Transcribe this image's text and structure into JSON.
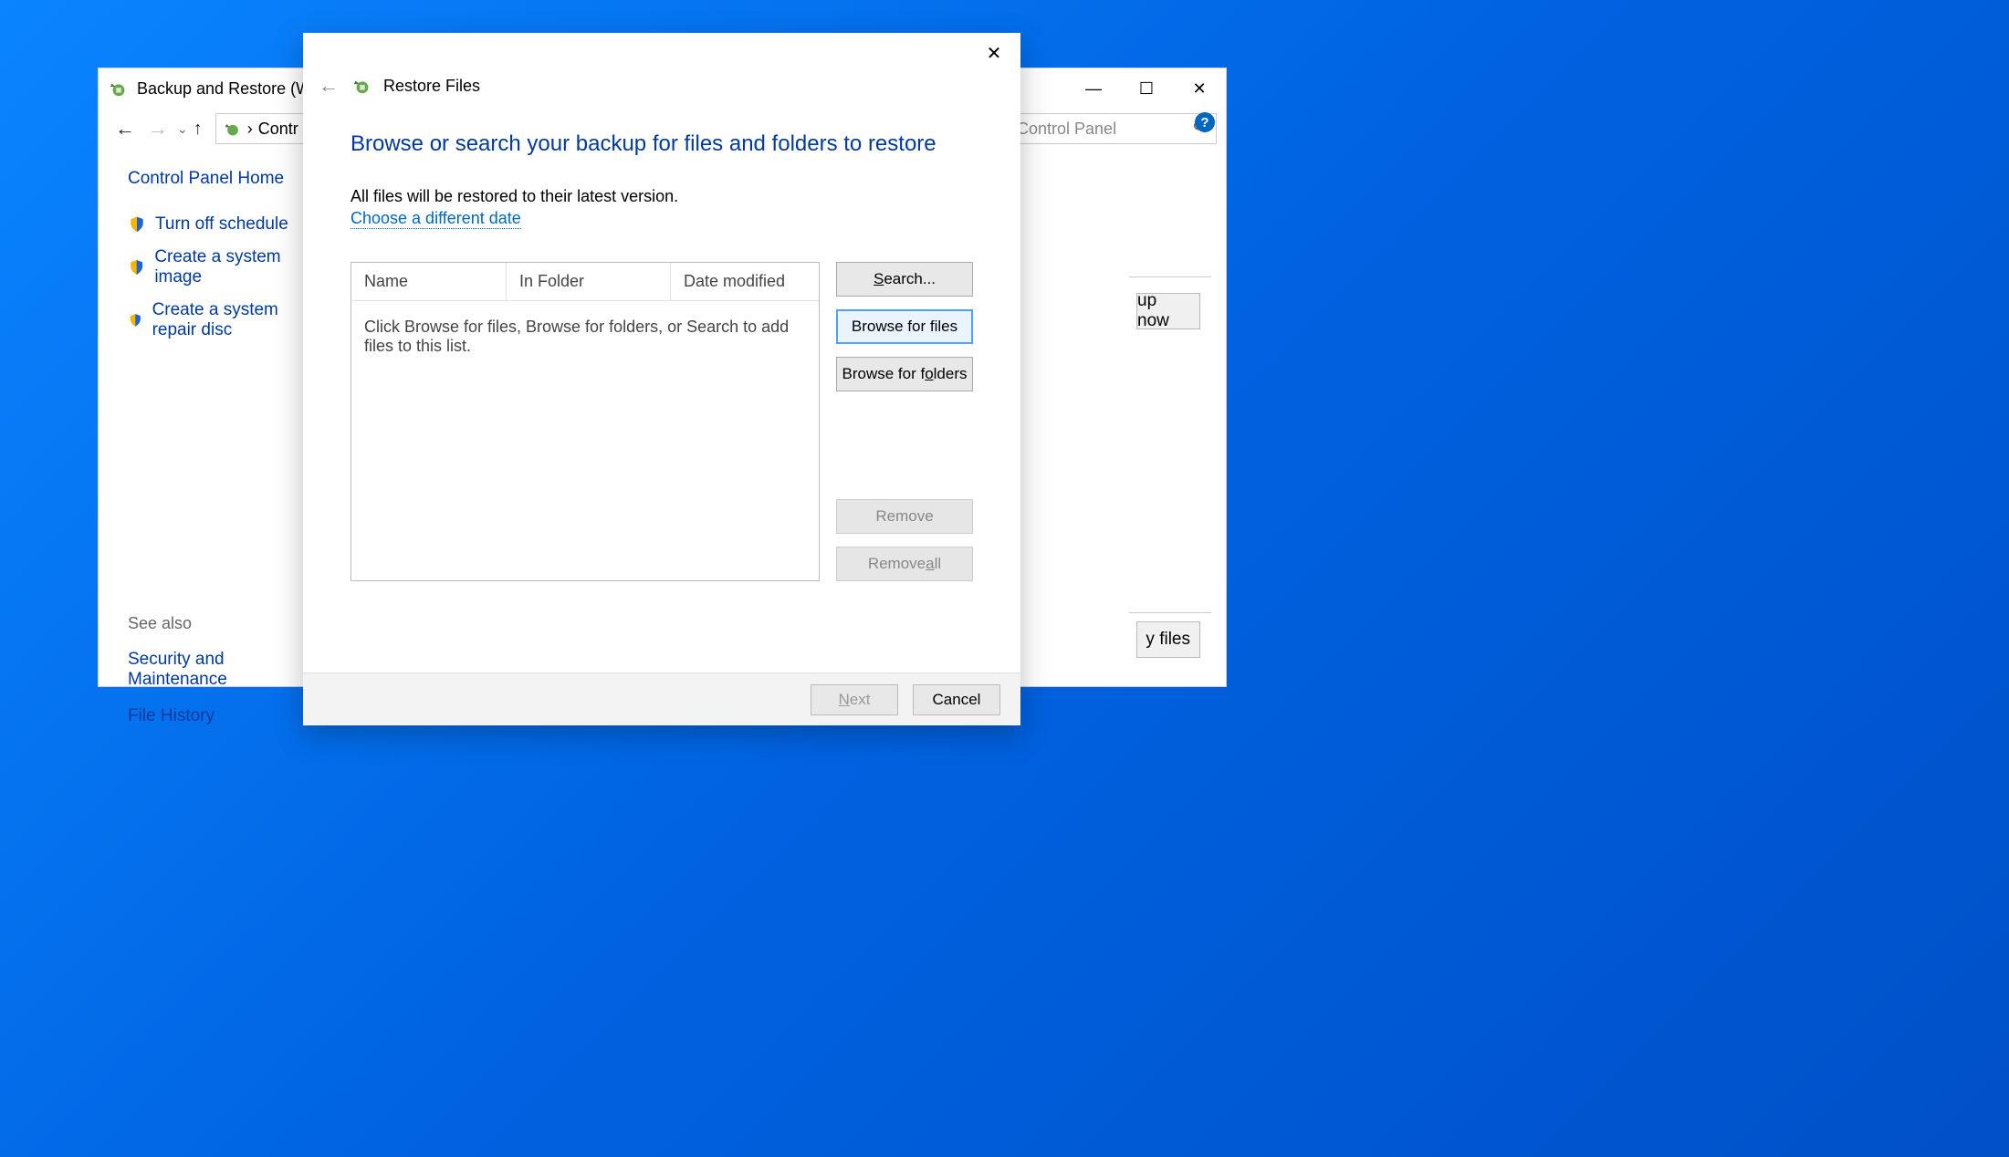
{
  "background_window": {
    "title": "Backup and Restore (Windo",
    "breadcrumb_text": "Contr",
    "search_placeholder": "Control Panel",
    "sidebar": {
      "home_label": "Control Panel Home",
      "tasks": [
        "Turn off schedule",
        "Create a system image",
        "Create a system repair disc"
      ],
      "see_also_heading": "See also",
      "see_also_links": [
        "Security and Maintenance",
        "File History"
      ]
    },
    "buttons": {
      "backup_now_partial": "up now",
      "my_files_partial": "y files"
    }
  },
  "dialog": {
    "title": "Restore Files",
    "heading": "Browse or search your backup for files and folders to restore",
    "subtext": "All files will be restored to their latest version.",
    "choose_date_link": "Choose a different date",
    "columns": {
      "name": "Name",
      "folder": "In Folder",
      "date": "Date modified"
    },
    "empty_message": "Click Browse for files, Browse for folders, or Search to add files to this list.",
    "side_buttons": {
      "search": "Search...",
      "browse_files": "Browse for files",
      "browse_folders": "Browse for folders",
      "remove": "Remove",
      "remove_all": "Remove all"
    },
    "footer": {
      "next": "Next",
      "cancel": "Cancel"
    }
  }
}
